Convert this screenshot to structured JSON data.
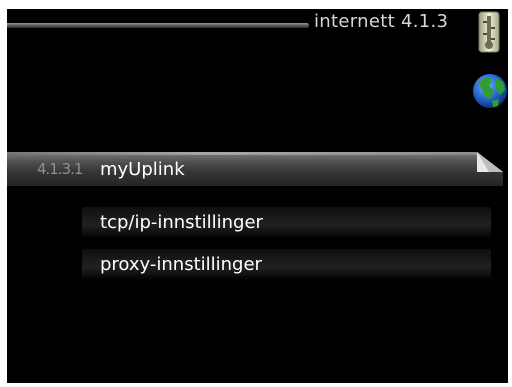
{
  "header": {
    "title": "internett 4.1.3",
    "thermometer_icon": "thermometer-icon",
    "globe_icon": "globe-icon"
  },
  "menu": {
    "items": [
      {
        "number": "4.1.3.1",
        "label": "myUplink",
        "selected": true
      },
      {
        "number": "",
        "label": "tcp/ip-innstillinger",
        "selected": false
      },
      {
        "number": "",
        "label": "proxy-innstillinger",
        "selected": false
      }
    ]
  },
  "colors": {
    "background": "#000000",
    "text": "#ffffff",
    "title_text": "#d6d6d6",
    "number_text": "#8f8f8f"
  }
}
